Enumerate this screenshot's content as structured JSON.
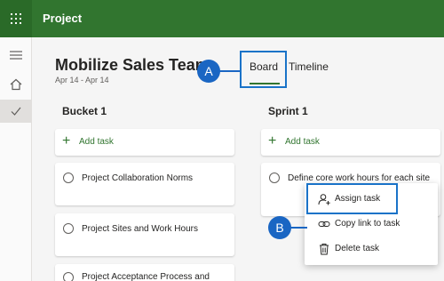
{
  "app": {
    "title": "Project",
    "accent": "#31752f"
  },
  "plan": {
    "name": "Mobilize Sales Team",
    "dates": "Apr 14 - Apr 14"
  },
  "tabs": [
    {
      "label": "Board",
      "selected": true
    },
    {
      "label": "Timeline",
      "selected": false
    }
  ],
  "callouts": {
    "a": "A",
    "b": "B"
  },
  "buckets": [
    {
      "name": "Bucket 1",
      "add_label": "Add task",
      "tasks": [
        "Project Collaboration Norms",
        "Project Sites and Work Hours",
        "Project Acceptance Process and"
      ]
    },
    {
      "name": "Sprint 1",
      "add_label": "Add task",
      "tasks": [
        "Define core work hours for each site"
      ]
    }
  ],
  "context_menu": {
    "items": [
      {
        "label": "Assign task",
        "icon": "assign-user-icon"
      },
      {
        "label": "Copy link to task",
        "icon": "link-icon"
      },
      {
        "label": "Delete task",
        "icon": "trash-icon"
      }
    ]
  },
  "icons": {
    "rail": [
      "hamburger-icon",
      "home-icon",
      "check-icon"
    ],
    "app_launcher": "waffle-icon"
  }
}
